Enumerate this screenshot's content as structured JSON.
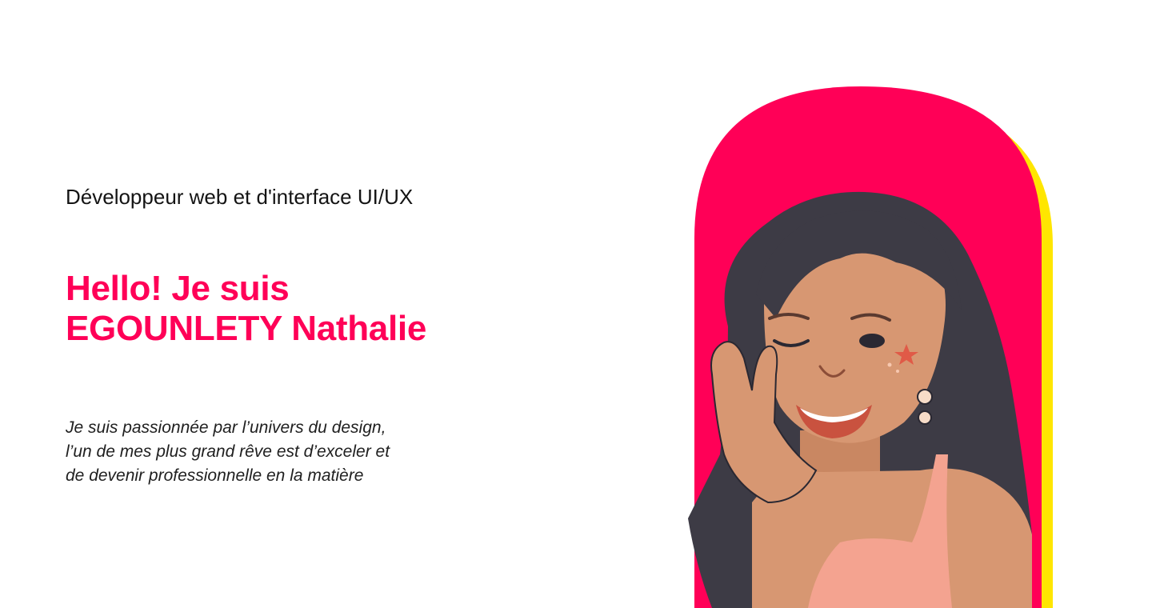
{
  "hero": {
    "role": "Développeur web et d'interface UI/UX",
    "headline_line1": "Hello! Je suis",
    "headline_line2": "EGOUNLETY Nathalie",
    "intro_line1": "Je suis passionnée par l’univers du design,",
    "intro_line2": "l’un de mes plus grand rêve est d’exceler et",
    "intro_line3": "de devenir professionnelle en la matière"
  },
  "portrait": {
    "icon": "avatar-illustration",
    "frame_color": "#ff0057",
    "accent_color": "#ffe600",
    "hair_color": "#3d3b45",
    "skin_color": "#d79772",
    "top_color": "#f4a390"
  },
  "colors": {
    "accent": "#ff0057",
    "text": "#141414",
    "background": "#ffffff"
  }
}
